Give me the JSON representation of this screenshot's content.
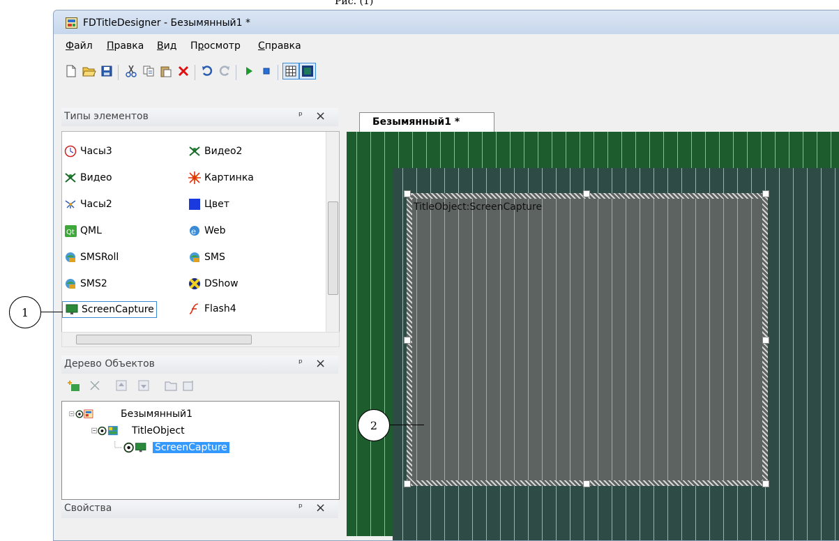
{
  "page_label": "Рис. (1)",
  "window": {
    "title": "FDTitleDesigner - Безымянный1 *"
  },
  "menu": [
    {
      "label": "Файл",
      "accel": "Ф",
      "rest": "айл"
    },
    {
      "label": "Правка",
      "accel": "П",
      "rest": "равка"
    },
    {
      "label": "Вид",
      "accel": "В",
      "rest": "ид"
    },
    {
      "label": "Просмотр",
      "pre": "П",
      "accel": "р",
      "rest": "осмотр"
    },
    {
      "label": "Справка",
      "accel": "С",
      "rest": "правка"
    }
  ],
  "toolbar": {
    "icons": [
      "new-icon",
      "open-icon",
      "save-icon",
      "cut-icon",
      "copy-icon",
      "paste-icon",
      "delete-icon",
      "undo-icon",
      "redo-icon",
      "play-icon",
      "stop-icon",
      "grid-icon",
      "frame-icon"
    ]
  },
  "types_panel": {
    "title": "Типы элементов",
    "pin": "ᵖ",
    "items": [
      {
        "label": "Часы3",
        "icon": "clock-icon"
      },
      {
        "label": "Видео2",
        "icon": "video-icon"
      },
      {
        "label": "Видео",
        "icon": "video-icon"
      },
      {
        "label": "Картинка",
        "icon": "picture-icon"
      },
      {
        "label": "Часы2",
        "icon": "clock-icon"
      },
      {
        "label": "Цвет",
        "icon": "color-icon"
      },
      {
        "label": "QML",
        "icon": "qml-icon"
      },
      {
        "label": "Web",
        "icon": "web-icon"
      },
      {
        "label": "SMSRoll",
        "icon": "sms-icon"
      },
      {
        "label": "SMS",
        "icon": "sms-icon"
      },
      {
        "label": "SMS2",
        "icon": "sms-icon"
      },
      {
        "label": "DShow",
        "icon": "dshow-icon"
      },
      {
        "label": "ScreenCapture",
        "icon": "screen-icon"
      },
      {
        "label": "Flash4",
        "icon": "flash-icon"
      }
    ]
  },
  "tree_panel": {
    "title": "Дерево Объектов",
    "nodes": [
      {
        "label": "Безымянный1"
      },
      {
        "label": "TitleObject"
      },
      {
        "label": "ScreenCapture"
      }
    ]
  },
  "props_panel": {
    "title": "Свойства"
  },
  "editor": {
    "tab_label": "Безымянный1 *",
    "object_label": "TitleObject:ScreenCapture"
  },
  "callouts": {
    "one": "1",
    "two": "2"
  },
  "colors": {
    "canvas_green": "#1d5c2d",
    "inner_teal": "#2f4b46",
    "object_gray": "#5d6360",
    "selection_blue": "#3399ff"
  }
}
